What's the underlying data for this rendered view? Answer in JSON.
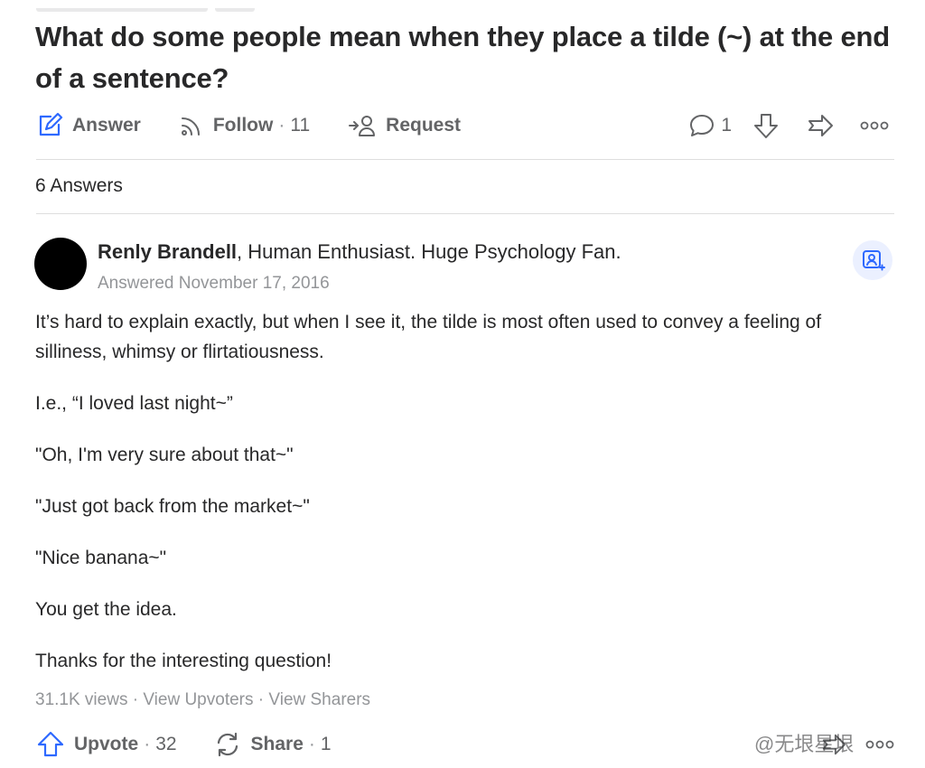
{
  "question": {
    "title": "What do some people mean when they place a tilde (~) at the end of a sentence?"
  },
  "question_actions": {
    "answer_label": "Answer",
    "follow_label": "Follow",
    "follow_sep": "·",
    "follow_count": "11",
    "request_label": "Request",
    "comment_count": "1"
  },
  "answers_header": "6 Answers",
  "answer": {
    "author_name": "Renly Brandell",
    "author_credential": ", Human Enthusiast. Huge Psychology Fan.",
    "date": "Answered November 17, 2016",
    "paragraphs": [
      "It’s hard to explain exactly, but when I see it, the tilde is most often used to convey a feeling of silliness, whimsy or flirtatiousness.",
      "I.e., “I loved last night~”",
      "\"Oh, I'm very sure about that~\"",
      "\"Just got back from the market~\"",
      "\"Nice banana~\"",
      "You get the idea.",
      "Thanks for the interesting question!"
    ],
    "views": "31.1K views",
    "sep": "·",
    "view_upvoters": "View Upvoters",
    "view_sharers": "View Sharers",
    "upvote_label": "Upvote",
    "upvote_count": "32",
    "share_label": "Share",
    "share_count": "1"
  },
  "watermark": "@无垠星垠",
  "colors": {
    "text_primary": "#282829",
    "text_secondary": "#636466",
    "text_muted": "#939598",
    "accent_blue": "#2e69ff",
    "divider": "#dedede",
    "follow_bg": "#ebf0ff"
  },
  "icons": {
    "answer": "pencil-square-icon",
    "follow": "wifi-signal-icon",
    "request": "request-person-icon",
    "comment": "speech-bubble-icon",
    "downvote": "down-arrow-icon",
    "share": "share-arrow-icon",
    "more": "more-dots-icon",
    "follow_author": "follow-person-icon",
    "upvote": "up-arrow-icon",
    "share_cycle": "share-cycle-icon"
  }
}
